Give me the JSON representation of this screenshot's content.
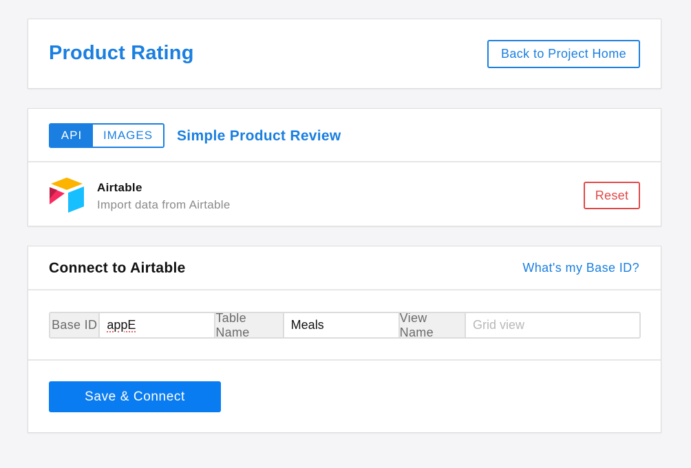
{
  "header": {
    "title": "Product Rating",
    "back_label": "Back to Project Home"
  },
  "source": {
    "tabs": [
      {
        "label": "API",
        "active": true
      },
      {
        "label": "IMAGES",
        "active": false
      }
    ],
    "project_name": "Simple Product Review",
    "integration": {
      "icon": "airtable-logo-icon",
      "title": "Airtable",
      "subtitle": "Import data from Airtable"
    },
    "reset_label": "Reset"
  },
  "connect": {
    "title": "Connect to Airtable",
    "help_link": "What's my Base ID?",
    "fields": {
      "base_id": {
        "label": "Base ID",
        "value": "appE"
      },
      "table_name": {
        "label": "Table Name",
        "value": "Meals"
      },
      "view_name": {
        "label": "View Name",
        "value": "",
        "placeholder": "Grid view"
      }
    },
    "save_label": "Save & Connect"
  },
  "colors": {
    "accent": "#1a7fe0",
    "primary_button": "#0a7cf2",
    "danger": "#e04848",
    "background": "#f5f5f7"
  }
}
